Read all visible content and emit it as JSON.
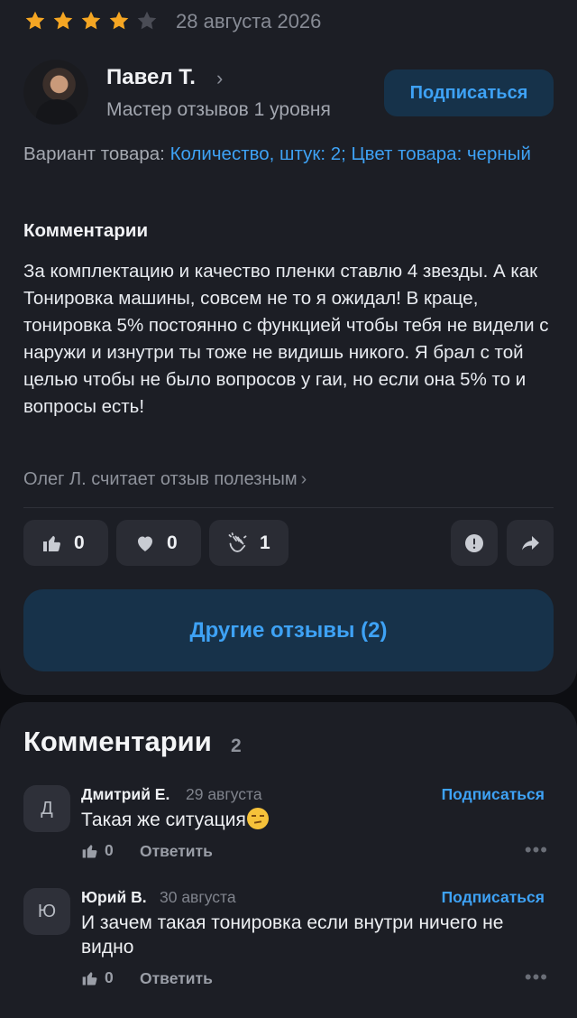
{
  "review": {
    "rating": 4,
    "rating_max": 5,
    "date": "28 августа 2026",
    "author": {
      "name": "Павел Т.",
      "level": "Мастер отзывов 1 уровня",
      "subscribe_label": "Подписаться"
    },
    "variant": {
      "label": "Вариант товара:",
      "value": "Количество, штук: 2; Цвет товара: черный"
    },
    "comments_heading": "Комментарии",
    "text": "За комплектацию и качество пленки ставлю 4 звезды. А как Тонировка машины, совсем не то я ожидал! В краце, тонировка 5% постоянно с функцией чтобы тебя не видели с наружи и изнутри ты тоже не видишь никого. Я брал с той целью чтобы не было вопросов у гаи, но если она 5% то и вопросы есть!",
    "useful_text": "Олег Л. считает отзыв полезным",
    "reactions": {
      "likes": "0",
      "hearts": "0",
      "claps": "1"
    },
    "other_reviews_label": "Другие отзывы (2)"
  },
  "comments_section": {
    "title": "Комментарии",
    "count": "2",
    "items": [
      {
        "initial": "Д",
        "name": "Дмитрий Е.",
        "date": "29 августа",
        "subscribe_label": "Подписаться",
        "text": "Такая же ситуация",
        "likes": "0",
        "reply_label": "Ответить",
        "more": "•••"
      },
      {
        "initial": "Ю",
        "name": "Юрий В.",
        "date": "30 августа",
        "subscribe_label": "Подписаться",
        "text": "И зачем такая тонировка если внутри ничего не видно",
        "likes": "0",
        "reply_label": "Ответить",
        "more": "•••"
      }
    ]
  },
  "colors": {
    "accent": "#3ea2f5",
    "star_filled": "#f5a623",
    "star_empty": "#4a4c55",
    "card_bg": "#1c1e25",
    "page_bg": "#0d0e12"
  },
  "icons": [
    "star-icon",
    "chevron-right-icon",
    "thumbs-up-icon",
    "heart-icon",
    "clap-icon",
    "warning-icon",
    "share-icon",
    "more-dots-icon",
    "emoji-unamused-icon"
  ]
}
